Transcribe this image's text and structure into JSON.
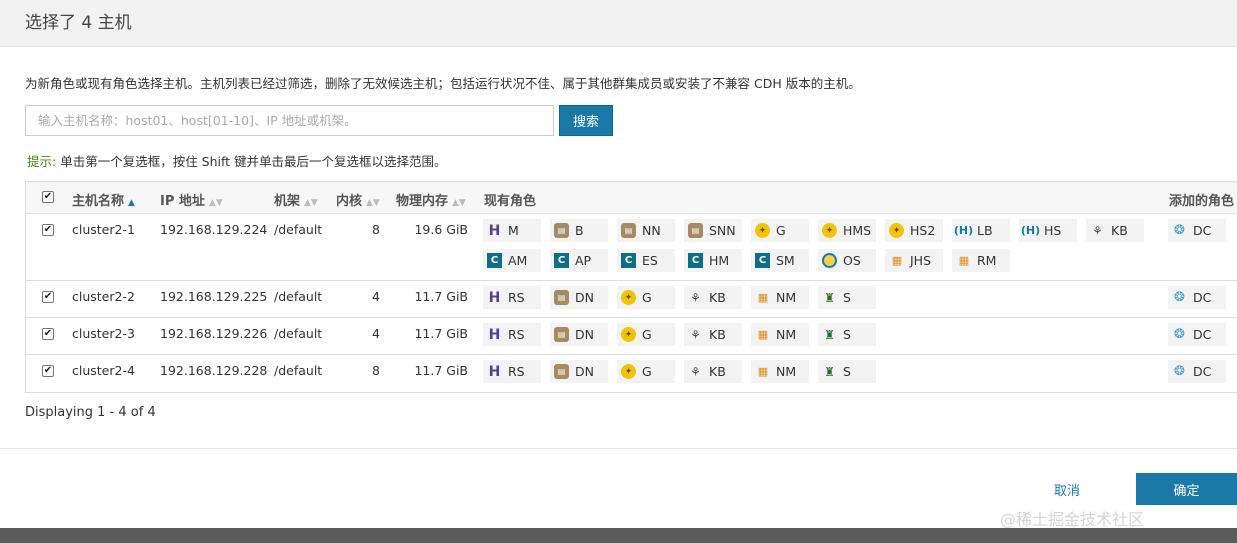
{
  "title": "选择了 4 主机",
  "intro": "为新角色或现有角色选择主机。主机列表已经过筛选，删除了无效候选主机；包括运行状况不佳、属于其他群集成员或安装了不兼容 CDH 版本的主机。",
  "search": {
    "placeholder": "输入主机名称：host01、host[01-10]、IP 地址或机架。",
    "button": "搜索"
  },
  "hint": {
    "label": "提示:",
    "text": " 单击第一个复选框，按住 Shift 键并单击最后一个复选框以选择范围。"
  },
  "columns": {
    "hostname": "主机名称",
    "ip": "IP 地址",
    "rack": "机架",
    "cores": "内核",
    "memory": "物理内存",
    "roles": "现有角色",
    "added": "添加的角色"
  },
  "rows": [
    {
      "hostname": "cluster2-1",
      "ip": "192.168.129.224",
      "rack": "/default",
      "cores": "8",
      "memory": "19.6 GiB",
      "roles": [
        [
          {
            "icon": "h",
            "label": "M"
          },
          {
            "icon": "b",
            "label": "B"
          },
          {
            "icon": "b",
            "label": "NN"
          },
          {
            "icon": "b",
            "label": "SNN"
          },
          {
            "icon": "g",
            "label": "G"
          },
          {
            "icon": "g",
            "label": "HMS"
          },
          {
            "icon": "g",
            "label": "HS2"
          },
          {
            "icon": "lb",
            "label": "LB"
          },
          {
            "icon": "lb",
            "label": "HS"
          },
          {
            "icon": "kb",
            "label": "KB"
          }
        ],
        [
          {
            "icon": "c",
            "label": "AM"
          },
          {
            "icon": "c",
            "label": "AP"
          },
          {
            "icon": "c",
            "label": "ES"
          },
          {
            "icon": "c",
            "label": "HM"
          },
          {
            "icon": "c",
            "label": "SM"
          },
          {
            "icon": "os",
            "label": "OS"
          },
          {
            "icon": "grid",
            "label": "JHS"
          },
          {
            "icon": "grid",
            "label": "RM"
          }
        ]
      ],
      "added": "DC"
    },
    {
      "hostname": "cluster2-2",
      "ip": "192.168.129.225",
      "rack": "/default",
      "cores": "4",
      "memory": "11.7 GiB",
      "roles": [
        [
          {
            "icon": "h",
            "label": "RS"
          },
          {
            "icon": "b",
            "label": "DN"
          },
          {
            "icon": "g",
            "label": "G"
          },
          {
            "icon": "kb",
            "label": "KB"
          },
          {
            "icon": "grid",
            "label": "NM"
          },
          {
            "icon": "s",
            "label": "S"
          }
        ]
      ],
      "added": "DC"
    },
    {
      "hostname": "cluster2-3",
      "ip": "192.168.129.226",
      "rack": "/default",
      "cores": "4",
      "memory": "11.7 GiB",
      "roles": [
        [
          {
            "icon": "h",
            "label": "RS"
          },
          {
            "icon": "b",
            "label": "DN"
          },
          {
            "icon": "g",
            "label": "G"
          },
          {
            "icon": "kb",
            "label": "KB"
          },
          {
            "icon": "grid",
            "label": "NM"
          },
          {
            "icon": "s",
            "label": "S"
          }
        ]
      ],
      "added": "DC"
    },
    {
      "hostname": "cluster2-4",
      "ip": "192.168.129.228",
      "rack": "/default",
      "cores": "8",
      "memory": "11.7 GiB",
      "roles": [
        [
          {
            "icon": "h",
            "label": "RS"
          },
          {
            "icon": "b",
            "label": "DN"
          },
          {
            "icon": "g",
            "label": "G"
          },
          {
            "icon": "kb",
            "label": "KB"
          },
          {
            "icon": "grid",
            "label": "NM"
          },
          {
            "icon": "s",
            "label": "S"
          }
        ]
      ],
      "added": "DC"
    }
  ],
  "footer": {
    "displaying": "Displaying 1 - 4 of 4",
    "cancel": "取消",
    "ok": "确定"
  },
  "watermark": "@稀土掘金技术社区",
  "colors": {
    "primary": "#1b79a8",
    "hint": "#3d8b16"
  }
}
